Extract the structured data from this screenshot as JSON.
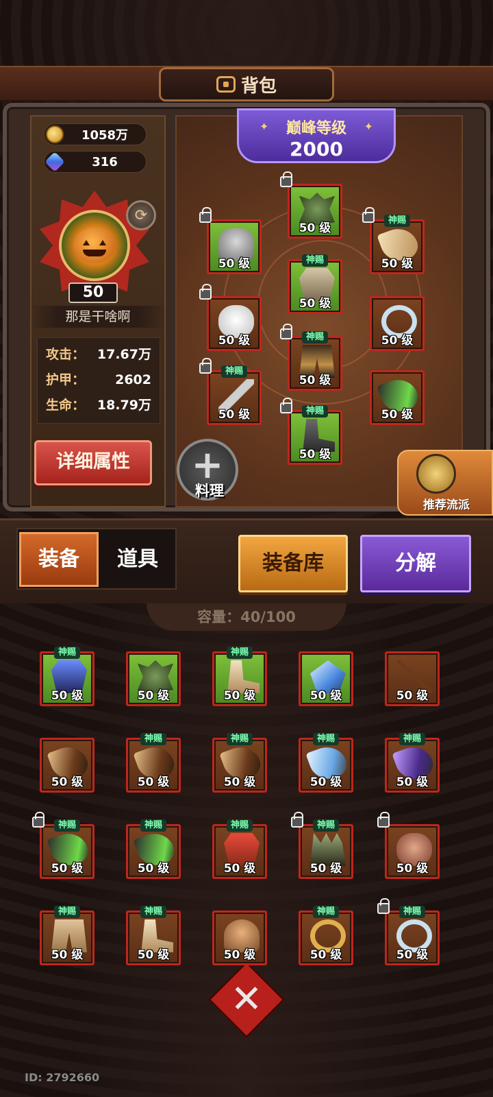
{
  "title": "背包",
  "currency": {
    "gold": "1058万",
    "gems": "316"
  },
  "player": {
    "level": "50",
    "name": "那是干啥啊",
    "stats": [
      {
        "key": "攻击：",
        "value": "17.67万"
      },
      {
        "key": "护甲：",
        "value": "2602"
      },
      {
        "key": "生命：",
        "value": "18.79万"
      }
    ],
    "detail_button": "详细属性"
  },
  "peak": {
    "title": "巅峰等级",
    "value": "2000"
  },
  "equipped": [
    {
      "icon": "dragon-helm-icon",
      "bg": "green",
      "level": "50 级",
      "tag": "",
      "locked": true
    },
    {
      "icon": "steel-helmet-icon",
      "bg": "green",
      "level": "50 级",
      "tag": "",
      "locked": true
    },
    {
      "icon": "ivory-horn-icon",
      "bg": "brown",
      "level": "50 级",
      "tag": "神赐",
      "locked": true
    },
    {
      "icon": "chest-armor-icon",
      "bg": "green",
      "level": "50 级",
      "tag": "神赐",
      "locked": false
    },
    {
      "icon": "white-glove-icon",
      "bg": "brown",
      "level": "50 级",
      "tag": "",
      "locked": true
    },
    {
      "icon": "silver-ring-icon",
      "bg": "brown",
      "level": "50 级",
      "tag": "",
      "locked": false
    },
    {
      "icon": "leg-armor-icon",
      "bg": "brown",
      "level": "50 级",
      "tag": "神赐",
      "locked": true
    },
    {
      "icon": "sword-icon",
      "bg": "brown",
      "level": "50 级",
      "tag": "神赐",
      "locked": true
    },
    {
      "icon": "green-horn-icon",
      "bg": "brown",
      "level": "50 级",
      "tag": "",
      "locked": false
    },
    {
      "icon": "iron-boots-icon",
      "bg": "green",
      "level": "50 级",
      "tag": "神赐",
      "locked": true
    }
  ],
  "cook_label": "料理",
  "recommend_label": "推荐流派",
  "tabs": {
    "equip": "装备",
    "items": "道具"
  },
  "buttons": {
    "warehouse": "装备库",
    "decompose": "分解"
  },
  "capacity": "容量：40/100",
  "inventory": [
    {
      "icon": "blue-armor-icon",
      "bg": "green",
      "level": "50 级",
      "tag": "神赐",
      "locked": false
    },
    {
      "icon": "dragon-head-icon",
      "bg": "green",
      "level": "50 级",
      "tag": "",
      "locked": false
    },
    {
      "icon": "cloth-boots-icon",
      "bg": "green",
      "level": "50 级",
      "tag": "神赐",
      "locked": false
    },
    {
      "icon": "blue-gem-icon",
      "bg": "green",
      "level": "50 级",
      "tag": "",
      "locked": false
    },
    {
      "icon": "staff-icon",
      "bg": "brown",
      "level": "50 级",
      "tag": "",
      "locked": false
    },
    {
      "icon": "brown-horn-icon",
      "bg": "brown",
      "level": "50 级",
      "tag": "",
      "locked": false
    },
    {
      "icon": "brown-horn-icon",
      "bg": "brown",
      "level": "50 级",
      "tag": "神赐",
      "locked": false
    },
    {
      "icon": "brown-horn-icon",
      "bg": "brown",
      "level": "50 级",
      "tag": "神赐",
      "locked": false
    },
    {
      "icon": "blue-horn-icon",
      "bg": "brown",
      "level": "50 级",
      "tag": "神赐",
      "locked": false
    },
    {
      "icon": "purple-horn-icon",
      "bg": "brown",
      "level": "50 级",
      "tag": "神赐",
      "locked": false
    },
    {
      "icon": "green-horn-icon",
      "bg": "brown",
      "level": "50 级",
      "tag": "神赐",
      "locked": true
    },
    {
      "icon": "green-horn-icon",
      "bg": "brown",
      "level": "50 级",
      "tag": "神赐",
      "locked": false
    },
    {
      "icon": "red-armor-icon",
      "bg": "brown",
      "level": "50 级",
      "tag": "神赐",
      "locked": false
    },
    {
      "icon": "claw-glove-icon",
      "bg": "brown",
      "level": "50 级",
      "tag": "神赐",
      "locked": true
    },
    {
      "icon": "leather-glove-icon",
      "bg": "brown",
      "level": "50 级",
      "tag": "",
      "locked": true
    },
    {
      "icon": "tan-pants-icon",
      "bg": "brown",
      "level": "50 级",
      "tag": "神赐",
      "locked": false
    },
    {
      "icon": "tan-boots-icon",
      "bg": "brown",
      "level": "50 级",
      "tag": "神赐",
      "locked": false
    },
    {
      "icon": "bronze-helmet-icon",
      "bg": "brown",
      "level": "50 级",
      "tag": "",
      "locked": false
    },
    {
      "icon": "gold-ring-icon",
      "bg": "brown",
      "level": "50 级",
      "tag": "神赐",
      "locked": false
    },
    {
      "icon": "silver-ring-icon",
      "bg": "brown",
      "level": "50 级",
      "tag": "神赐",
      "locked": true
    }
  ],
  "player_id": "ID: 2792660",
  "colors": {
    "accent_red": "#c0261c",
    "accent_purple": "#5a2a9c",
    "accent_orange": "#f2a640"
  }
}
